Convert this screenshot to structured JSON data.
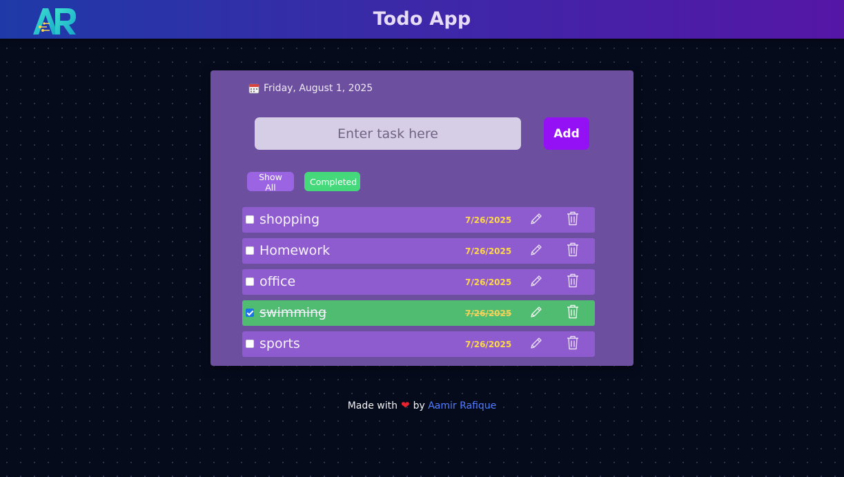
{
  "header": {
    "logo_text": "AR",
    "title": "Todo App",
    "gradient_start": "#1f3aa8",
    "gradient_end": "#5516a6"
  },
  "card": {
    "date": "Friday, August 1, 2025",
    "input_placeholder": "Enter task here",
    "input_value": "",
    "add_label": "Add",
    "filters": {
      "show_all": "Show All",
      "completed": "Completed"
    },
    "tasks": [
      {
        "text": "shopping",
        "date": "7/26/2025",
        "completed": false
      },
      {
        "text": "Homework",
        "date": "7/26/2025",
        "completed": false
      },
      {
        "text": "office",
        "date": "7/26/2025",
        "completed": false
      },
      {
        "text": "swimming",
        "date": "7/26/2025",
        "completed": true
      },
      {
        "text": "sports",
        "date": "7/26/2025",
        "completed": false
      }
    ]
  },
  "footer": {
    "made_with": "Made with",
    "heart": "❤",
    "by": "by",
    "author": "Aamir Rafique"
  },
  "colors": {
    "background": "#060b1c",
    "card": "#6c4f9f",
    "task_row": "#8f5ccf",
    "task_row_done": "#4fbc72",
    "add_button": "#9410f5",
    "date_text": "#ffd84a",
    "author_link": "#4f7dff"
  }
}
